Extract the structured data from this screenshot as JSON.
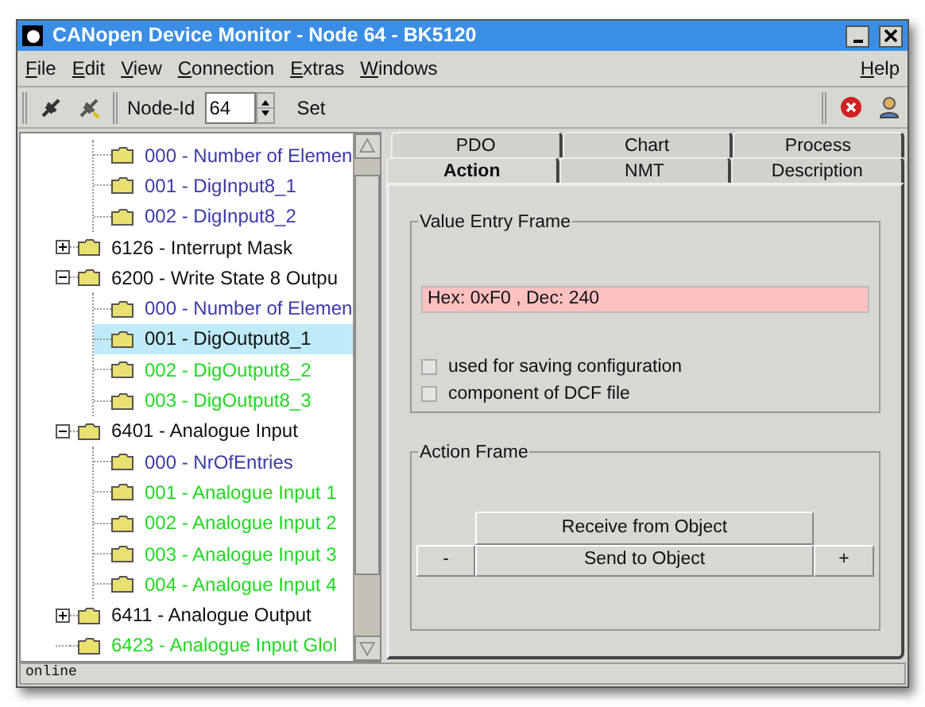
{
  "window": {
    "title": "CANopen Device Monitor - Node 64 - BK5120"
  },
  "menu": {
    "items": [
      {
        "label": "File",
        "underlined": true
      },
      {
        "label": "Edit",
        "underlined": true
      },
      {
        "label": "View",
        "underlined": true
      },
      {
        "label": "Connection",
        "underlined": true
      },
      {
        "label": "Extras",
        "underlined": true
      },
      {
        "label": "Windows",
        "underlined": true
      }
    ],
    "help": {
      "label": "Help",
      "underlined": true
    }
  },
  "toolbar": {
    "node_id_label": "Node-Id",
    "node_id": "64",
    "set_label": "Set"
  },
  "tree": {
    "items": [
      {
        "children": [
          {
            "label": "000 - Number of Elemen",
            "color": "#3a3aa6",
            "selected": false
          },
          {
            "label": "001 - DigInput8_1",
            "color": "#3a3aa6",
            "selected": false
          },
          {
            "label": "002 - DigInput8_2",
            "color": "#3a3aa6",
            "selected": false
          }
        ]
      },
      {
        "label": "6126 - Interrupt Mask",
        "color": "#111111",
        "selected": false,
        "expanded": false
      },
      {
        "label": "6200 - Write State 8 Outpu",
        "color": "#111111",
        "selected": false,
        "expanded": true,
        "children": [
          {
            "label": "000 - Number of Elemen",
            "color": "#3a3aa6",
            "selected": false
          },
          {
            "label": "001 - DigOutput8_1",
            "color": "#111111",
            "selected": true
          },
          {
            "label": "002 - DigOutput8_2",
            "color": "#22d822",
            "selected": false
          },
          {
            "label": "003 - DigOutput8_3",
            "color": "#22d822",
            "selected": false
          }
        ]
      },
      {
        "label": "6401 - Analogue Input",
        "color": "#111111",
        "selected": false,
        "expanded": true,
        "children": [
          {
            "label": "000 - NrOfEntries",
            "color": "#3a3aa6",
            "selected": false
          },
          {
            "label": "001 - Analogue Input 1",
            "color": "#22d822",
            "selected": false
          },
          {
            "label": "002 - Analogue Input 2",
            "color": "#22d822",
            "selected": false
          },
          {
            "label": "003 - Analogue Input 3",
            "color": "#22d822",
            "selected": false
          },
          {
            "label": "004 - Analogue Input 4",
            "color": "#22d822",
            "selected": false
          }
        ]
      },
      {
        "label": "6411 - Analogue Output",
        "color": "#111111",
        "selected": false,
        "expanded": false
      },
      {
        "label": "6423 - Analogue Input Glol",
        "color": "#22d822",
        "selected": false
      }
    ]
  },
  "tabs": {
    "rows": [
      [
        {
          "label": "PDO",
          "selected": false
        },
        {
          "label": "Chart",
          "selected": false
        },
        {
          "label": "Process",
          "selected": false
        }
      ],
      [
        {
          "label": "Action",
          "selected": true
        },
        {
          "label": "NMT",
          "selected": false
        },
        {
          "label": "Description",
          "selected": false
        }
      ]
    ]
  },
  "value_entry_frame": {
    "title": "Value Entry Frame",
    "value": "Hex: 0xF0 , Dec: 240",
    "checkboxes": [
      {
        "label": "used for saving configuration",
        "checked": false
      },
      {
        "label": "component of DCF file",
        "checked": false
      }
    ]
  },
  "action_frame": {
    "title": "Action Frame",
    "receive": "Receive from Object",
    "minus": "-",
    "send": "Send to Object",
    "plus": "+"
  },
  "status_bar": {
    "text": "online"
  }
}
